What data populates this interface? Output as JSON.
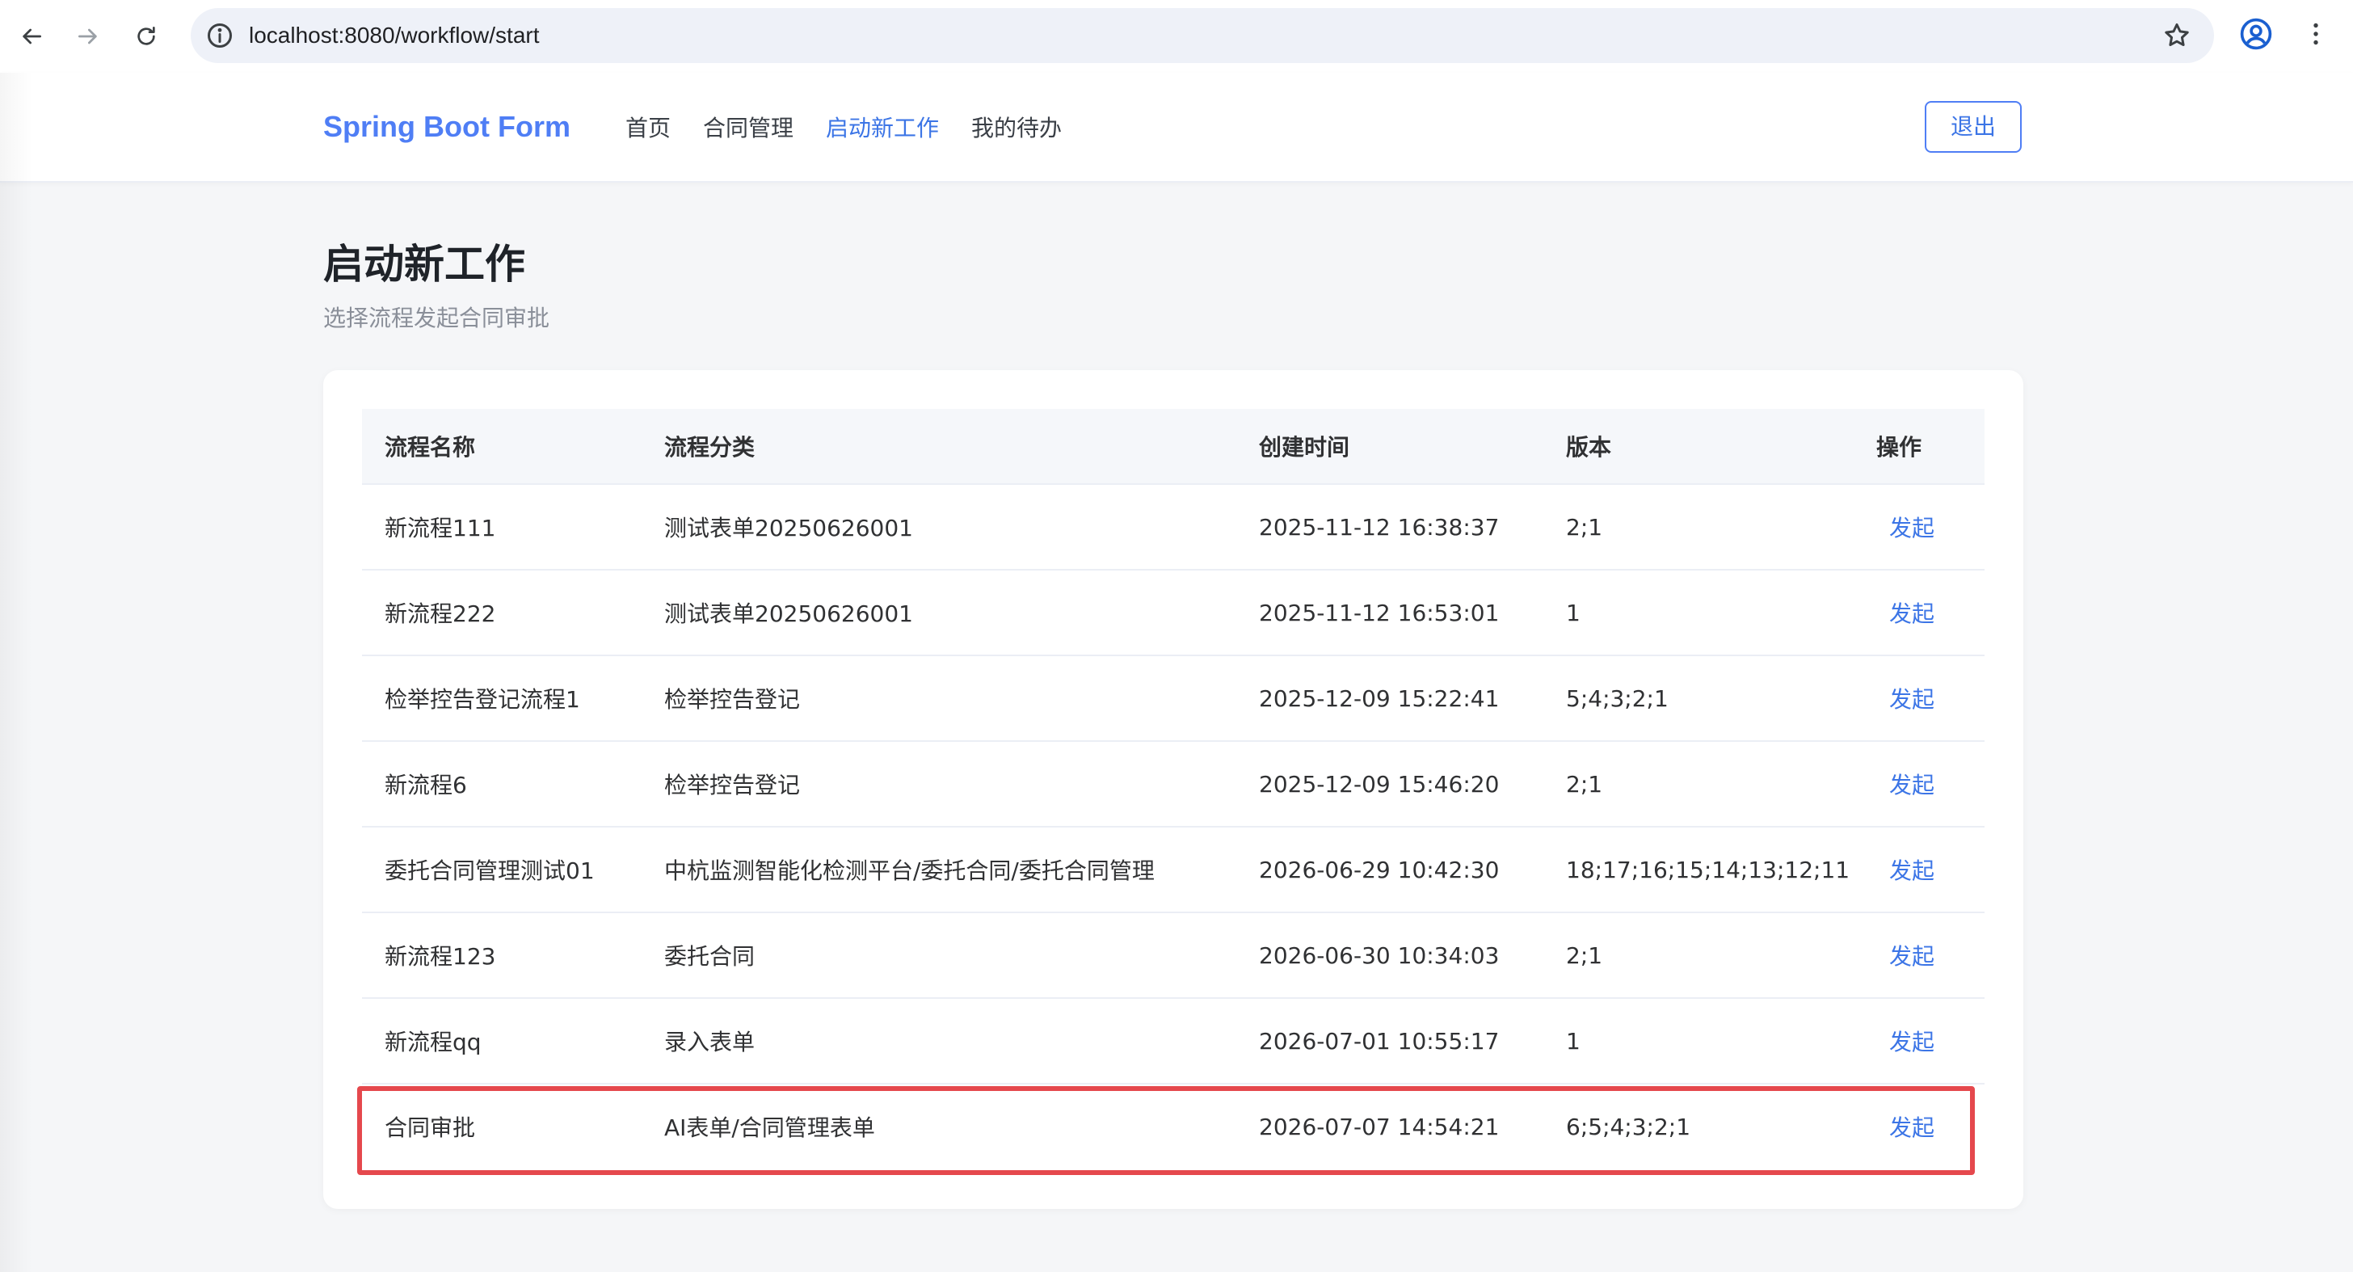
{
  "browser": {
    "url": "localhost:8080/workflow/start"
  },
  "header": {
    "brand": "Spring Boot Form",
    "nav": [
      {
        "label": "首页",
        "active": false
      },
      {
        "label": "合同管理",
        "active": false
      },
      {
        "label": "启动新工作",
        "active": true
      },
      {
        "label": "我的待办",
        "active": false
      }
    ],
    "logout_label": "退出"
  },
  "page": {
    "title": "启动新工作",
    "subtitle": "选择流程发起合同审批"
  },
  "table": {
    "columns": [
      "流程名称",
      "流程分类",
      "创建时间",
      "版本",
      "操作"
    ],
    "rows": [
      {
        "name": "新流程111",
        "category": "测试表单20250626001",
        "created": "2025-11-12 16:38:37",
        "version": "2;1",
        "action": "发起"
      },
      {
        "name": "新流程222",
        "category": "测试表单20250626001",
        "created": "2025-11-12 16:53:01",
        "version": "1",
        "action": "发起"
      },
      {
        "name": "检举控告登记流程1",
        "category": "检举控告登记",
        "created": "2025-12-09 15:22:41",
        "version": "5;4;3;2;1",
        "action": "发起"
      },
      {
        "name": "新流程6",
        "category": "检举控告登记",
        "created": "2025-12-09 15:46:20",
        "version": "2;1",
        "action": "发起"
      },
      {
        "name": "委托合同管理测试01",
        "category": "中杭监测智能化检测平台/委托合同/委托合同管理",
        "created": "2026-06-29 10:42:30",
        "version": "18;17;16;15;14;13;12;11",
        "action": "发起"
      },
      {
        "name": "新流程123",
        "category": "委托合同",
        "created": "2026-06-30 10:34:03",
        "version": "2;1",
        "action": "发起"
      },
      {
        "name": "新流程qq",
        "category": "录入表单",
        "created": "2026-07-01 10:55:17",
        "version": "1",
        "action": "发起"
      },
      {
        "name": "合同审批",
        "category": "AI表单/合同管理表单",
        "created": "2026-07-07 14:54:21",
        "version": "6;5;4;3;2;1",
        "action": "发起"
      }
    ]
  },
  "colors": {
    "brand": "#4f7ef5",
    "link": "#3c75e6",
    "highlight": "#e5484d"
  }
}
